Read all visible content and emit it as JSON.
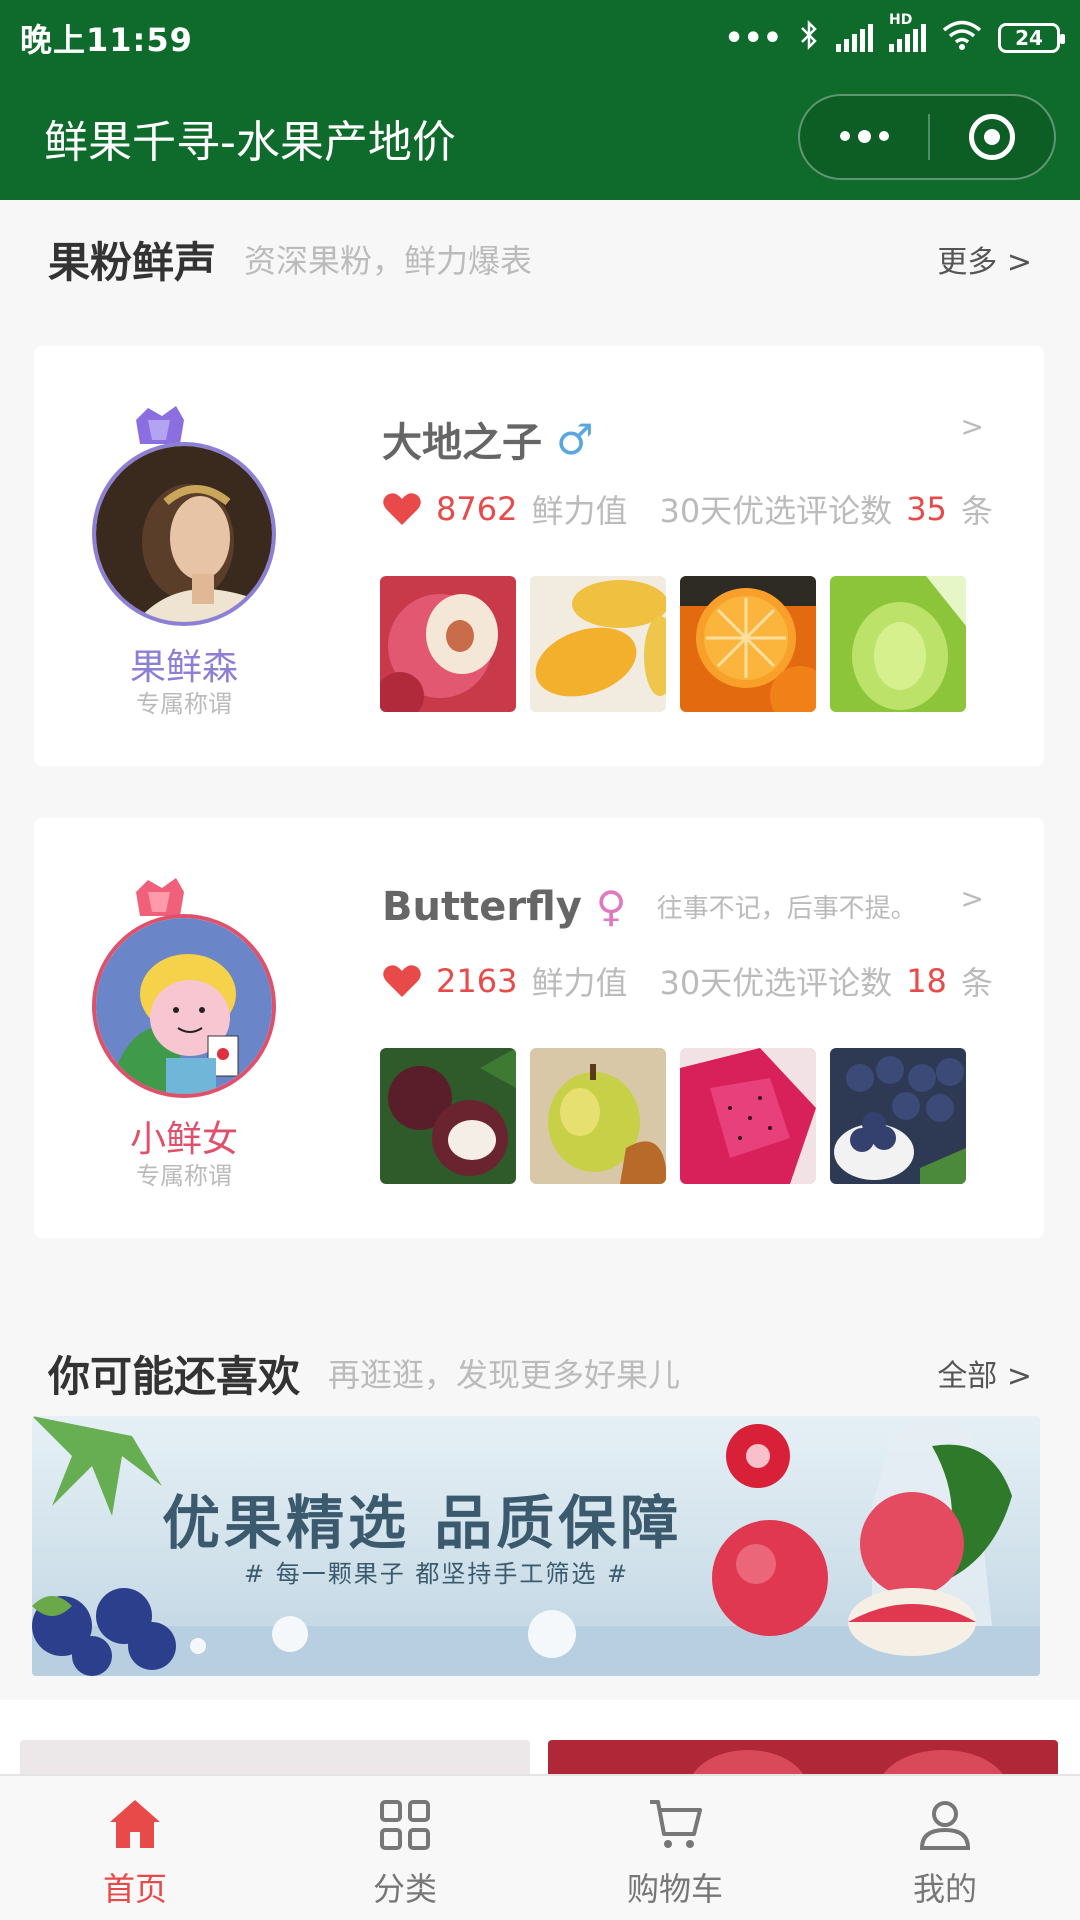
{
  "status": {
    "time": "晚上11:59",
    "signal_text": "•••",
    "hd": "HD",
    "battery": "24"
  },
  "nav": {
    "title": "鲜果千寻-水果产地价"
  },
  "section1": {
    "title": "果粉鲜声",
    "subtitle": "资深果粉，鲜力爆表",
    "more": "更多 >"
  },
  "users": [
    {
      "nickname": "果鲜森",
      "nick_sub": "专属称谓",
      "name": "大地之子",
      "gender": "♂",
      "signature": "",
      "chevron": ">",
      "fresh_power": "8762",
      "fresh_label": "鲜力值",
      "comments_label": "30天优选评论数",
      "comments": "35",
      "comments_unit": "条",
      "accent": "#8b7fd6",
      "gender_color": "#59a7e0",
      "thumbs": [
        "peach",
        "mango",
        "orange",
        "melon"
      ]
    },
    {
      "nickname": "小鲜女",
      "nick_sub": "专属称谓",
      "name": "Butterfly",
      "gender": "♀",
      "signature": "往事不记，后事不提。",
      "chevron": ">",
      "fresh_power": "2163",
      "fresh_label": "鲜力值",
      "comments_label": "30天优选评论数",
      "comments": "18",
      "comments_unit": "条",
      "accent": "#e0506a",
      "gender_color": "#e07ac0",
      "thumbs": [
        "mangosteen",
        "pear",
        "dragonfruit",
        "blueberry"
      ]
    }
  ],
  "section2": {
    "title": "你可能还喜欢",
    "subtitle": "再逛逛，发现更多好果儿",
    "more": "全部 >"
  },
  "banner": {
    "title": "优果精选 品质保障",
    "subtitle": "# 每一颗果子 都坚持手工筛选 #"
  },
  "tabs": [
    {
      "label": "首页",
      "icon": "home-icon",
      "active": true
    },
    {
      "label": "分类",
      "icon": "grid-icon",
      "active": false
    },
    {
      "label": "购物车",
      "icon": "cart-icon",
      "active": false
    },
    {
      "label": "我的",
      "icon": "user-icon",
      "active": false
    }
  ],
  "colors": {
    "brand": "#0e6b2b",
    "accent_red": "#e84a4a"
  }
}
